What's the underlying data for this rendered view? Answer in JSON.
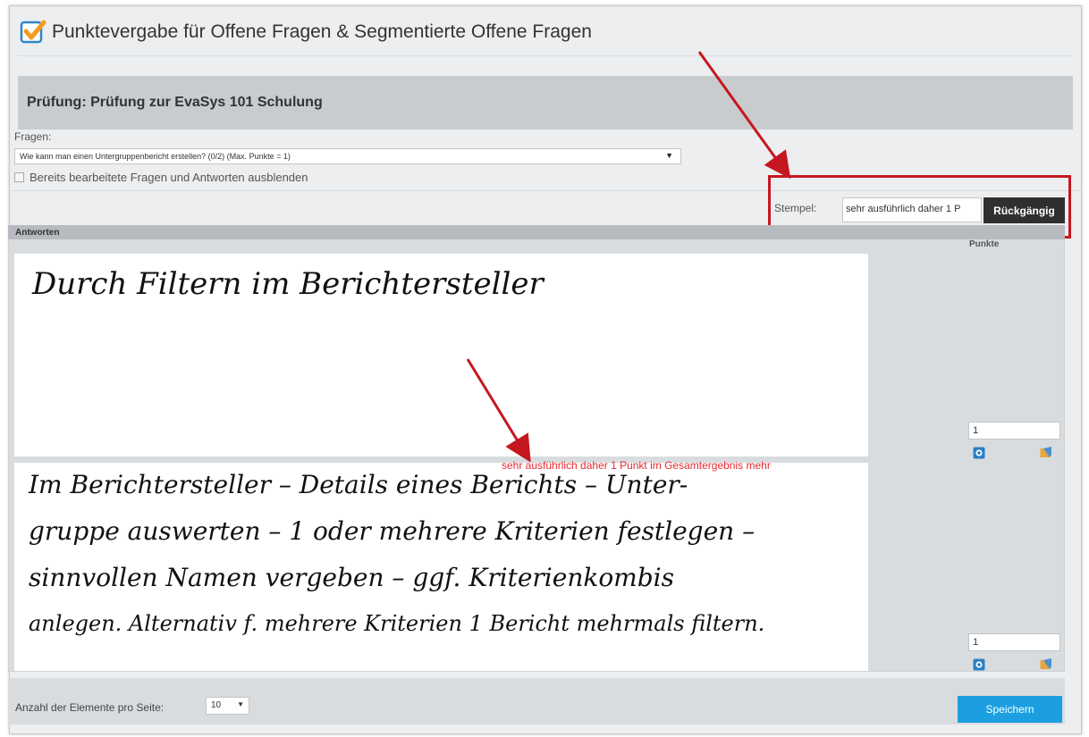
{
  "page": {
    "title": "Punktevergabe für Offene Fragen & Segmentierte Offene Fragen"
  },
  "exam": {
    "title": "Prüfung: Prüfung zur EvaSys 101 Schulung"
  },
  "questions": {
    "label": "Fragen:",
    "selected": "Wie kann man einen Untergruppenbericht erstellen? (0/2) (Max. Punkte = 1)",
    "hide_label": "Bereits bearbeitete Fragen und Antworten ausblenden"
  },
  "stamp": {
    "label": "Stempel:",
    "value": "sehr ausführlich daher 1 P",
    "undo_label": "Rückgängig"
  },
  "answers": {
    "header": "Antworten",
    "points_header": "Punkte",
    "items": [
      {
        "text_lines": [
          "Durch Filtern im Berichtersteller"
        ],
        "score": "1",
        "stamp_overlay": ""
      },
      {
        "text_lines": [
          "Im Berichtersteller – Details eines Berichts – Unter-",
          "gruppe auswerten – 1 oder mehrere Kriterien festlegen –",
          "sinnvollen Namen vergeben – ggf. Kriterienkombis",
          "anlegen. Alternativ f. mehrere Kriterien 1 Bericht mehrmals filtern."
        ],
        "score": "1",
        "stamp_overlay": "sehr ausführlich daher 1 Punkt im Gesamtergebnis mehr"
      }
    ]
  },
  "footer": {
    "per_page_label": "Anzahl der Elemente pro Seite:",
    "per_page_value": "10",
    "save_label": "Speichern"
  },
  "colors": {
    "accent_blue": "#1b9fe0",
    "annotation_red": "#c5171f",
    "title_check_orange": "#f39c1f"
  }
}
